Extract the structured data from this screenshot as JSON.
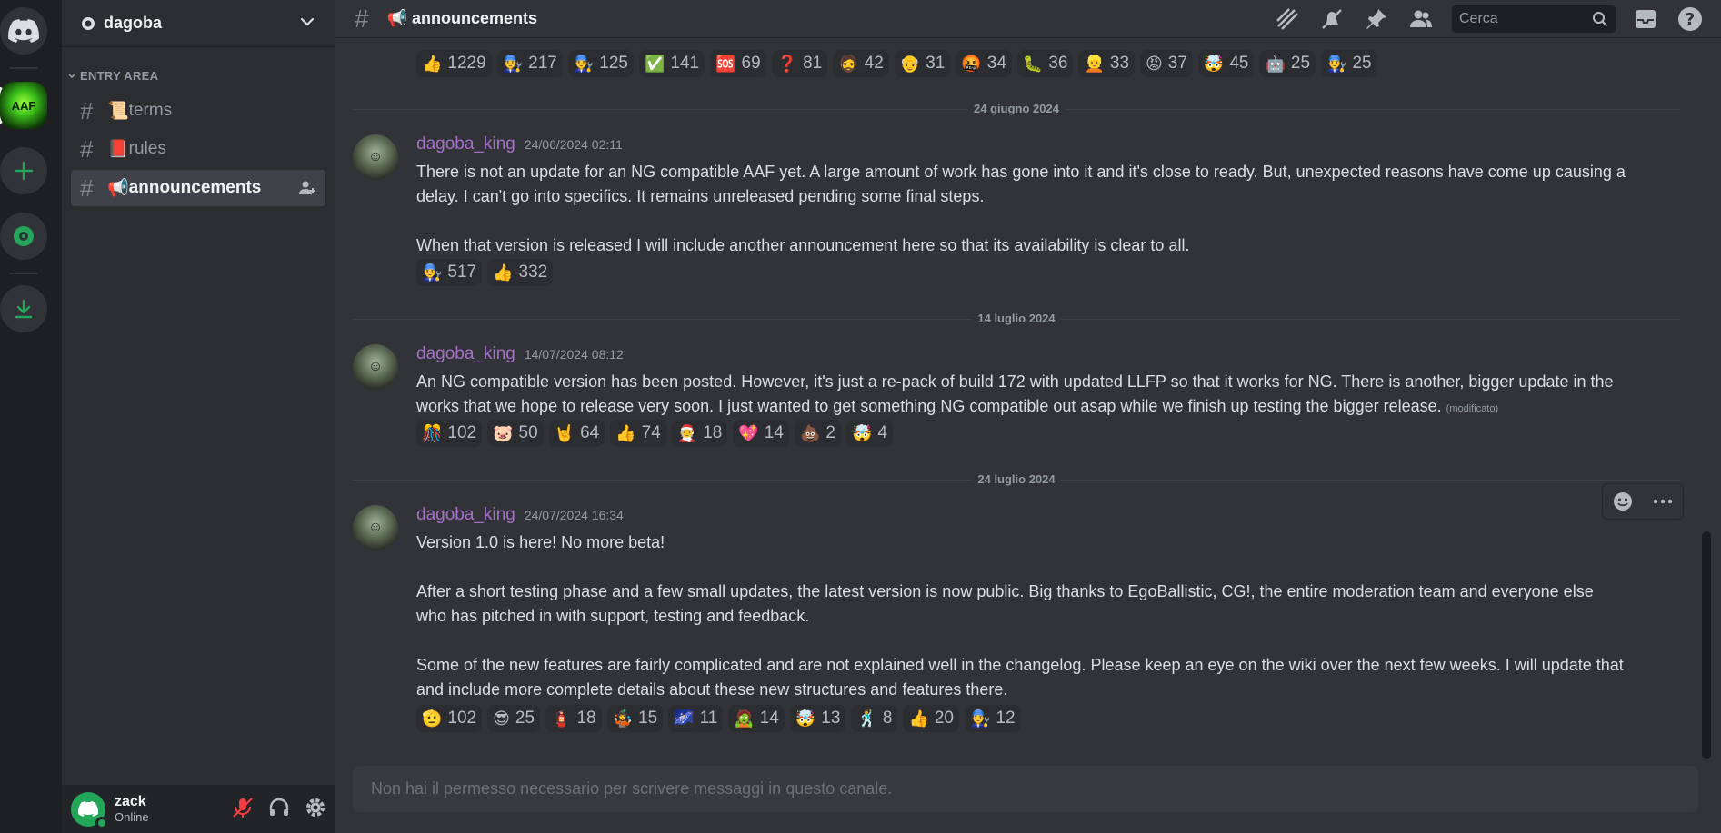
{
  "server": {
    "name": "dagoba",
    "rail": [
      "discord-home",
      "aaf-server",
      "add-server",
      "explore",
      "download"
    ],
    "aaf_label": "AAF"
  },
  "sidebar": {
    "category": "ENTRY AREA",
    "channels": [
      {
        "emoji": "📜",
        "name": "terms"
      },
      {
        "emoji": "📕",
        "name": "rules"
      },
      {
        "emoji": "📢",
        "name": "announcements"
      }
    ]
  },
  "user": {
    "name": "zack",
    "status": "Online"
  },
  "channel": {
    "emoji": "📢",
    "title": "announcements"
  },
  "search": {
    "placeholder": "Cerca"
  },
  "top_reactions": [
    {
      "e": "👍",
      "c": "1229"
    },
    {
      "e": "👨‍🔧",
      "c": "217"
    },
    {
      "e": "👨‍🔧",
      "c": "125"
    },
    {
      "e": "✅",
      "c": "141"
    },
    {
      "e": "🆘",
      "c": "69"
    },
    {
      "e": "❓",
      "c": "81"
    },
    {
      "e": "🧔",
      "c": "42"
    },
    {
      "e": "👴",
      "c": "31"
    },
    {
      "e": "🤬",
      "c": "34"
    },
    {
      "e": "🐛",
      "c": "36"
    },
    {
      "e": "👱",
      "c": "33"
    },
    {
      "e": "😡",
      "c": "37"
    },
    {
      "e": "🤯",
      "c": "45"
    },
    {
      "e": "🤖",
      "c": "25"
    },
    {
      "e": "👨‍🔧",
      "c": "25"
    }
  ],
  "dividers": [
    "24 giugno 2024",
    "14 luglio 2024",
    "24 luglio 2024"
  ],
  "messages": [
    {
      "author": "dagoba_king",
      "time": "24/06/2024 02:11",
      "text": "There is not an update for an NG compatible AAF yet. A large amount of work has gone into it and it's close to ready. But, unexpected reasons have come up causing a delay. I can't go into specifics. It remains unreleased pending some final steps.\n\nWhen that version is released I will include another announcement here so that its availability is clear to all.",
      "edited": "",
      "reactions": [
        {
          "e": "👨‍🔧",
          "c": "517"
        },
        {
          "e": "👍",
          "c": "332"
        }
      ]
    },
    {
      "author": "dagoba_king",
      "time": "14/07/2024 08:12",
      "text": "An NG compatible version has been posted. However, it's just a re-pack of build 172 with updated LLFP so that it works for NG. There is another, bigger update in the works that we hope to release very soon. I just wanted to get something NG compatible out asap while we finish up testing the bigger release.",
      "edited": "(modificato)",
      "reactions": [
        {
          "e": "🎊",
          "c": "102"
        },
        {
          "e": "🐷",
          "c": "50"
        },
        {
          "e": "🤘",
          "c": "64"
        },
        {
          "e": "👍",
          "c": "74"
        },
        {
          "e": "🧑‍🎄",
          "c": "18"
        },
        {
          "e": "💖",
          "c": "14"
        },
        {
          "e": "💩",
          "c": "2"
        },
        {
          "e": "🤯",
          "c": "4"
        }
      ]
    },
    {
      "author": "dagoba_king",
      "time": "24/07/2024 16:34",
      "text": "Version 1.0 is here! No more beta!\n\nAfter a short testing phase and a few small updates, the latest version is now public. Big thanks to EgoBallistic, CG!, the entire moderation team and everyone else who has pitched in with support, testing and feedback.\n\nSome of the new features are fairly complicated and are not explained well in the changelog. Please keep an eye on the wiki over the next few weeks. I will update that and include more complete details about these new structures and features there.",
      "edited": "",
      "reactions": [
        {
          "e": "🫡",
          "c": "102"
        },
        {
          "e": "😎",
          "c": "25"
        },
        {
          "e": "🧯",
          "c": "18"
        },
        {
          "e": "🤹",
          "c": "15"
        },
        {
          "e": "🌌",
          "c": "11"
        },
        {
          "e": "🧟",
          "c": "14"
        },
        {
          "e": "🤯",
          "c": "13"
        },
        {
          "e": "🕺",
          "c": "8"
        },
        {
          "e": "👍",
          "c": "20"
        },
        {
          "e": "👨‍🔧",
          "c": "12"
        }
      ]
    }
  ],
  "composer": {
    "placeholder": "Non hai il permesso necessario per scrivere messaggi in questo canale."
  },
  "colors": {
    "author": "#a571c7",
    "green": "#23a55a",
    "danger": "#f23f43"
  }
}
